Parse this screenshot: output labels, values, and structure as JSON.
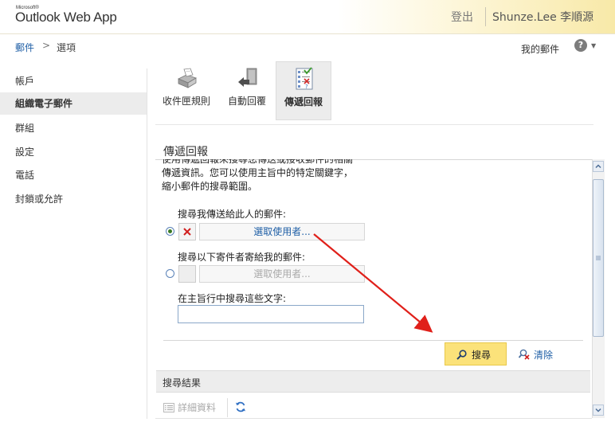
{
  "header": {
    "logo_small": "Microsoft®",
    "logo_main": "Outlook Web App",
    "signout": "登出",
    "username": "Shunze.Lee 李順源"
  },
  "breadcrumb": {
    "mail": "郵件",
    "arrow": ">",
    "options": "選項"
  },
  "topright": {
    "my_mail": "我的郵件",
    "help": "?"
  },
  "nav": {
    "items": [
      {
        "label": "帳戶"
      },
      {
        "label": "組織電子郵件"
      },
      {
        "label": "群組"
      },
      {
        "label": "設定"
      },
      {
        "label": "電話"
      },
      {
        "label": "封鎖或允許"
      }
    ]
  },
  "toolbar": {
    "buttons": [
      {
        "label": "收件匣規則",
        "icon": "inbox-rules-icon"
      },
      {
        "label": "自動回覆",
        "icon": "auto-reply-icon"
      },
      {
        "label": "傳遞回報",
        "icon": "delivery-report-icon"
      }
    ]
  },
  "section": {
    "title": "傳遞回報",
    "desc_line0": "使用傳遞回報來搜尋您傳送或接收郵件的相關",
    "desc_line1": "傳遞資訊。您可以使用主旨中的特定關鍵字，",
    "desc_line2": "縮小郵件的搜尋範圍。"
  },
  "form": {
    "sent_to_label": "搜尋我傳送給此人的郵件:",
    "select_user_1": "選取使用者...",
    "received_from_label": "搜尋以下寄件者寄給我的郵件:",
    "select_user_2": "選取使用者...",
    "subject_label": "在主旨行中搜尋這些文字:",
    "subject_value": ""
  },
  "actions": {
    "search": "搜尋",
    "clear": "清除"
  },
  "results": {
    "title": "搜尋結果",
    "details": "詳細資料"
  },
  "colors": {
    "link": "#1f5fa6",
    "search_button": "#fbe27a",
    "arrow": "#e0201a"
  }
}
